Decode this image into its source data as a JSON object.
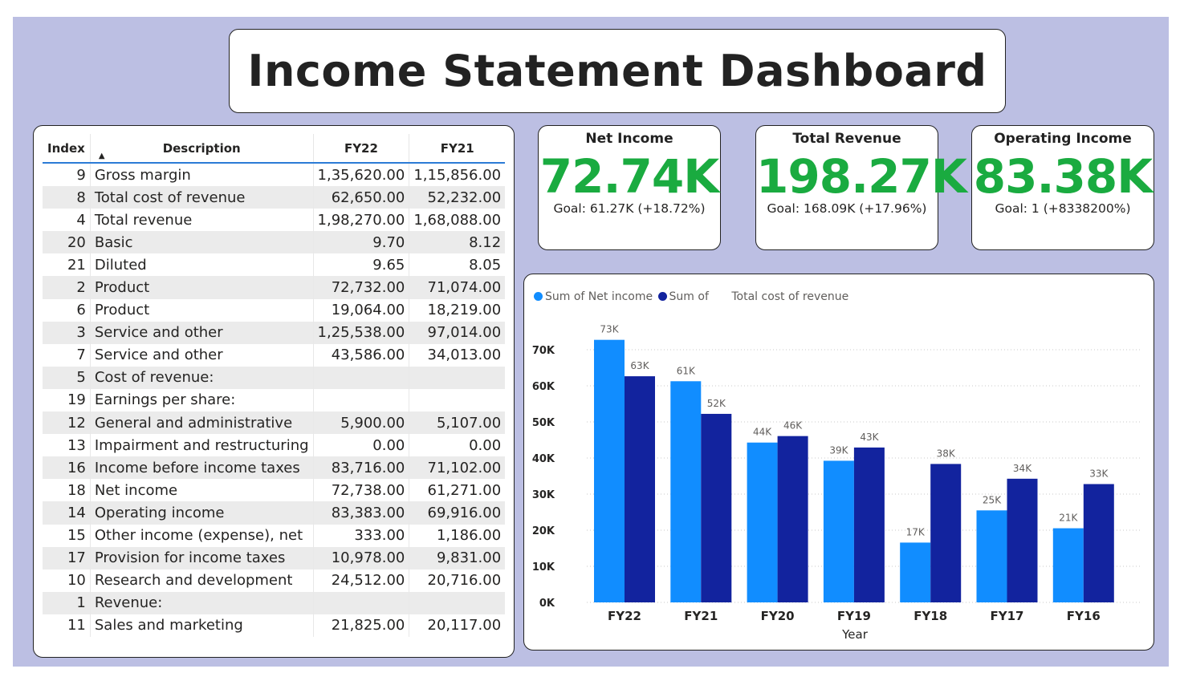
{
  "title": "Income Statement Dashboard",
  "table": {
    "headers": [
      "Index",
      "Description",
      "FY22",
      "FY21"
    ],
    "sort_indicator": "▲",
    "rows": [
      [
        "9",
        "Gross margin",
        "1,35,620.00",
        "1,15,856.00"
      ],
      [
        "8",
        "Total cost of revenue",
        "62,650.00",
        "52,232.00"
      ],
      [
        "4",
        "Total revenue",
        "1,98,270.00",
        "1,68,088.00"
      ],
      [
        "20",
        "Basic",
        "9.70",
        "8.12"
      ],
      [
        "21",
        "Diluted",
        "9.65",
        "8.05"
      ],
      [
        "2",
        "Product",
        "72,732.00",
        "71,074.00"
      ],
      [
        "6",
        "Product",
        "19,064.00",
        "18,219.00"
      ],
      [
        "3",
        "Service and other",
        "1,25,538.00",
        "97,014.00"
      ],
      [
        "7",
        "Service and other",
        "43,586.00",
        "34,013.00"
      ],
      [
        "5",
        "Cost of revenue:",
        "",
        ""
      ],
      [
        "19",
        "Earnings per share:",
        "",
        ""
      ],
      [
        "12",
        "General and administrative",
        "5,900.00",
        "5,107.00"
      ],
      [
        "13",
        "Impairment and restructuring",
        "0.00",
        "0.00"
      ],
      [
        "16",
        "Income before income taxes",
        "83,716.00",
        "71,102.00"
      ],
      [
        "18",
        "Net income",
        "72,738.00",
        "61,271.00"
      ],
      [
        "14",
        "Operating income",
        "83,383.00",
        "69,916.00"
      ],
      [
        "15",
        "Other income (expense), net",
        "333.00",
        "1,186.00"
      ],
      [
        "17",
        "Provision for income taxes",
        "10,978.00",
        "9,831.00"
      ],
      [
        "10",
        "Research and development",
        "24,512.00",
        "20,716.00"
      ],
      [
        "1",
        "Revenue:",
        "",
        ""
      ],
      [
        "11",
        "Sales and marketing",
        "21,825.00",
        "20,117.00"
      ]
    ]
  },
  "kpis": [
    {
      "title": "Net Income",
      "value": "72.74K",
      "goal": "Goal: 61.27K (+18.72%)"
    },
    {
      "title": "Total Revenue",
      "value": "198.27K",
      "goal": "Goal: 168.09K (+17.96%)"
    },
    {
      "title": "Operating Income",
      "value": "83.38K",
      "goal": "Goal: 1 (+8338200%)"
    }
  ],
  "colors": {
    "canvas": "#bcbfe3",
    "kpi_value": "#1aab40",
    "series1": "#118dff",
    "series2": "#12239e"
  },
  "chart_data": {
    "type": "bar",
    "legend": [
      "Sum of Net income",
      "Sum of",
      "Total cost of revenue"
    ],
    "xlabel": "Year",
    "ylabel": "",
    "categories": [
      "FY22",
      "FY21",
      "FY20",
      "FY19",
      "FY18",
      "FY17",
      "FY16"
    ],
    "yticks": [
      "0K",
      "10K",
      "20K",
      "30K",
      "40K",
      "50K",
      "60K",
      "70K"
    ],
    "ylim": [
      0,
      75000
    ],
    "grid": true,
    "legend_position": "top-left",
    "series": [
      {
        "name": "Sum of Net income",
        "color": "#118dff",
        "values": [
          72738,
          61271,
          44281,
          39240,
          16571,
          25489,
          20539
        ],
        "labels": [
          "73K",
          "61K",
          "44K",
          "39K",
          "17K",
          "25K",
          "21K"
        ]
      },
      {
        "name": "Sum of Total cost of revenue",
        "color": "#12239e",
        "values": [
          62650,
          52232,
          46078,
          42910,
          38353,
          34261,
          32780
        ],
        "labels": [
          "63K",
          "52K",
          "46K",
          "43K",
          "38K",
          "34K",
          "33K"
        ]
      }
    ]
  }
}
